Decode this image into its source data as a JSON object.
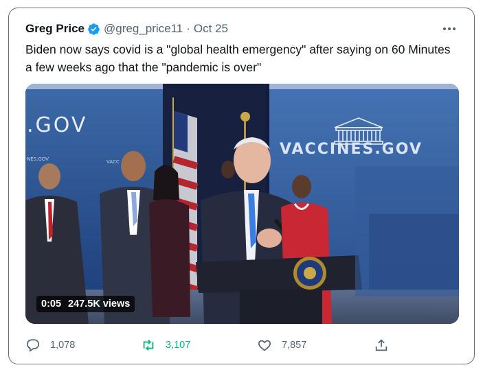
{
  "tweet": {
    "author_name": "Greg Price",
    "handle": "@greg_price11",
    "separator": "·",
    "date": "Oct 25",
    "text": "Biden now says covid is a \"global health emergency\" after saying on 60 Minutes a few weeks ago that the \"pandemic is over\"",
    "verified_icon": "verified-badge-icon",
    "more_icon": "more-options-icon"
  },
  "video": {
    "duration": "0:05",
    "views": "247.5K views",
    "backdrop_left_text": ".GOV",
    "backdrop_small_text": "NES.GOV",
    "backdrop_small_text_2": "VACC",
    "backdrop_right_text": "VACCINES.GOV"
  },
  "actions": {
    "reply_count": "1,078",
    "retweet_count": "3,107",
    "like_count": "7,857",
    "reply_icon": "reply-icon",
    "retweet_icon": "retweet-icon",
    "like_icon": "heart-icon",
    "share_icon": "share-icon"
  },
  "colors": {
    "retweet_accent": "#00ba7c",
    "verified_blue": "#1d9bf0",
    "secondary_text": "#536471"
  }
}
